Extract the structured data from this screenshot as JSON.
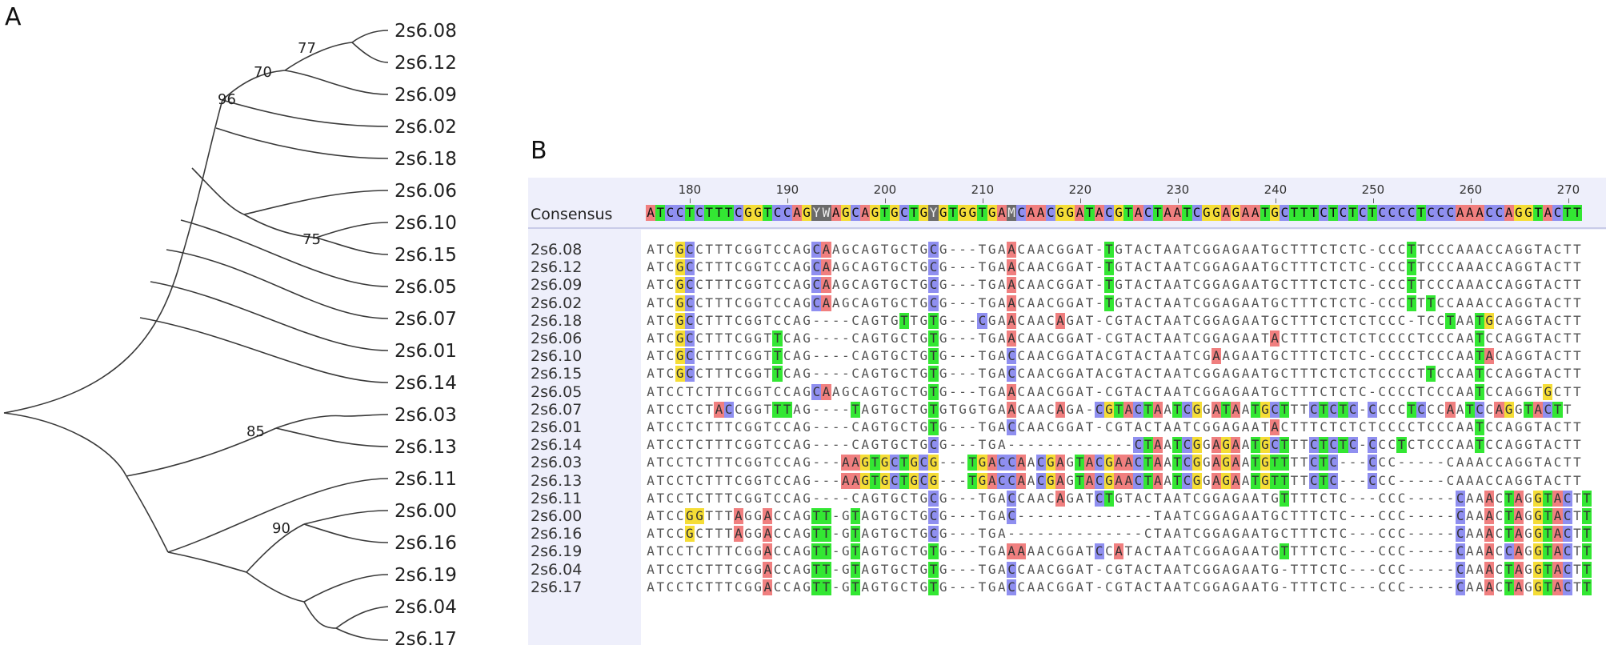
{
  "panel_labels": {
    "a": "A",
    "b": "B"
  },
  "tree": {
    "taxa": [
      "2s6.08",
      "2s6.12",
      "2s6.09",
      "2s6.02",
      "2s6.18",
      "2s6.06",
      "2s6.10",
      "2s6.15",
      "2s6.05",
      "2s6.07",
      "2s6.01",
      "2s6.14",
      "2s6.03",
      "2s6.13",
      "2s6.11",
      "2s6.00",
      "2s6.16",
      "2s6.19",
      "2s6.04",
      "2s6.17"
    ],
    "bootstrap": [
      "77",
      "70",
      "96",
      "75",
      "85",
      "90"
    ]
  },
  "alignment": {
    "consensus_label": "Consensus",
    "ruler_ticks": [
      "180",
      "190",
      "200",
      "210",
      "220",
      "230",
      "240",
      "250",
      "260",
      "270"
    ],
    "consensus": "ATCCTCTTTCGGTCCAGYWAGCAGTGCTGYGTGGTGAMCAACGGATACGTACTAATCGGAGAATGCTTTCTCTCTCCCCTCCCAAACCAGGTACTT",
    "rows": [
      {
        "name": "2s6.08",
        "seq": "ATCGCCTTTCGGTCCAGCAAGCAGTGCTGCG---TGAACAACGGAT-TGTACTAATCGGAGAATGCTTTCTCTC-CCCTTCCCAAACCAGGTACTT"
      },
      {
        "name": "2s6.12",
        "seq": "ATCGCCTTTCGGTCCAGCAAGCAGTGCTGCG---TGAACAACGGAT-TGTACTAATCGGAGAATGCTTTCTCTC-CCCTTCCCAAACCAGGTACTT"
      },
      {
        "name": "2s6.09",
        "seq": "ATCGCCTTTCGGTCCAGCAAGCAGTGCTGCG---TGAACAACGGAT-TGTACTAATCGGAGAATGCTTTCTCTC-CCCTTCCCAAACCAGGTACTT"
      },
      {
        "name": "2s6.02",
        "seq": "ATCGCCTTTCGGTCCAGCAAGCAGTGCTGCG---TGAACAACGGAT-TGTACTAATCGGAGAATGCTTTCTCTC-CCCTTTCCAAACCAGGTACTT"
      },
      {
        "name": "2s6.18",
        "seq": "ATCGCCTTTCGGTCCAG----CAGTGTTGTG---CGAACAACAGAT-CGTACTAATCGGAGAATGCTTTCTCTCTCCC-TCCTAATGCAGGTACTT"
      },
      {
        "name": "2s6.06",
        "seq": "ATCGCCTTTCGGTTCAG----CAGTGCTGTG---TGAACAACGGAT-CGTACTAATCGGAGAATACTTTCTCTCTCCCCTCCCAATCCAGGTACTT"
      },
      {
        "name": "2s6.10",
        "seq": "ATCGCCTTTCGGTTCAG----CAGTGCTGTG---TGACCAACGGATACGTACTAATCGAAGAATGCTTTCTCTC-CCCCTCCCAATACAGGTACTT"
      },
      {
        "name": "2s6.15",
        "seq": "ATCGCCTTTCGGTTCAG----CAGTGCTGTG---TGACCAACGGATACGTACTAATCGGAGAATGCTTTCTCTCTCCCCTTCCAATCCAGGTACTT"
      },
      {
        "name": "2s6.05",
        "seq": "ATCCTCTTTCGGTCCAGCAAGCAGTGCTGTG---TGAACAACGGAT-CGTACTAATCGGAGAATGCTTTCTCTC-CCCCTCCCAATCCAGGTGCTT"
      },
      {
        "name": "2s6.07",
        "seq": "ATCCTCTACCGGTTTAG----TAGTGCTGTGTGGTGAACAACAGA-CGTACTAATCGGATAATGCTTTCTCTC-CCCCTCCCAATCCAGGTACTT"
      },
      {
        "name": "2s6.01",
        "seq": "ATCCTCTTTCGGTCCAG----CAGTGCTGTG---TGACCAACGGAT-CGTACTAATCGGAGAATACTTTCTCTCTCCCCTCCCAATCCAGGTACTT"
      },
      {
        "name": "2s6.14",
        "seq": "ATCCTCTTTCGGTCCAG----CAGTGCTGCG---TGA-------------CTAATCGGAGAATGCTTTCTCTC-CCCTCTCCCAATCCAGGTACTT"
      },
      {
        "name": "2s6.03",
        "seq": "ATCCTCTTTCGGTCCAG---AAGTGCTGCG---TGACCAACGAGTACGAACTAATCGGAGAATGTTTTCTC---CCC-----CAAACCAGGTACTT"
      },
      {
        "name": "2s6.13",
        "seq": "ATCCTCTTTCGGTCCAG---AAGTGCTGCG---TGACCAACGAGTACGAACTAATCGGAGAATGTTTTCTC---CCC-----CAAACCAGGTACTT"
      },
      {
        "name": "2s6.11",
        "seq": "ATCCTCTTTCGGTCCAG----CAGTGCTGCG---TGACCAACAGATCTGTACTAATCGGAGAATGTTTTCTC---CCC-----CAAACTAGGTACTT"
      },
      {
        "name": "2s6.00",
        "seq": "ATCCGGTTTAGGACCAGTT-GTAGTGCTGCG---TGAC--------------TAATCGGAGAATGCTTTCTC---CCC-----CAAACTAGGTACTT"
      },
      {
        "name": "2s6.16",
        "seq": "ATCCGCTTTAGGACCAGTT-GTAGTGCTGCG---TGA--------------CTAATCGGAGAATGCTTTCTC---CCC-----CAAACTAGGTACTT"
      },
      {
        "name": "2s6.19",
        "seq": "ATCCTCTTTCGGACCAGTT-GTAGTGCTGTG---TGAAAAACGGATCCATACTAATCGGAGAATGTTTTCTC---CCC-----CAAACCAGGTACTT"
      },
      {
        "name": "2s6.04",
        "seq": "ATCCTCTTTCGGACCAGTT-GTAGTGCTGTG---TGACCAACGGAT-CGTACTAATCGGAGAATG-TTTCTC---CCC-----CAAACTAGGTACTT"
      },
      {
        "name": "2s6.17",
        "seq": "ATCCTCTTTCGGACCAGTT-GTAGTGCTGTG---TGACCAACGGAT-CGTACTAATCGGAGAATG-TTTCTC---CCC-----CAAACTAGGTACTT"
      }
    ]
  },
  "colors": {
    "A": "#f07f7f",
    "C": "#8f8ff0",
    "G": "#f5dd36",
    "T": "#33e733",
    "ambiguous": "#6b6b6b",
    "branch": "#3a3a3a"
  }
}
